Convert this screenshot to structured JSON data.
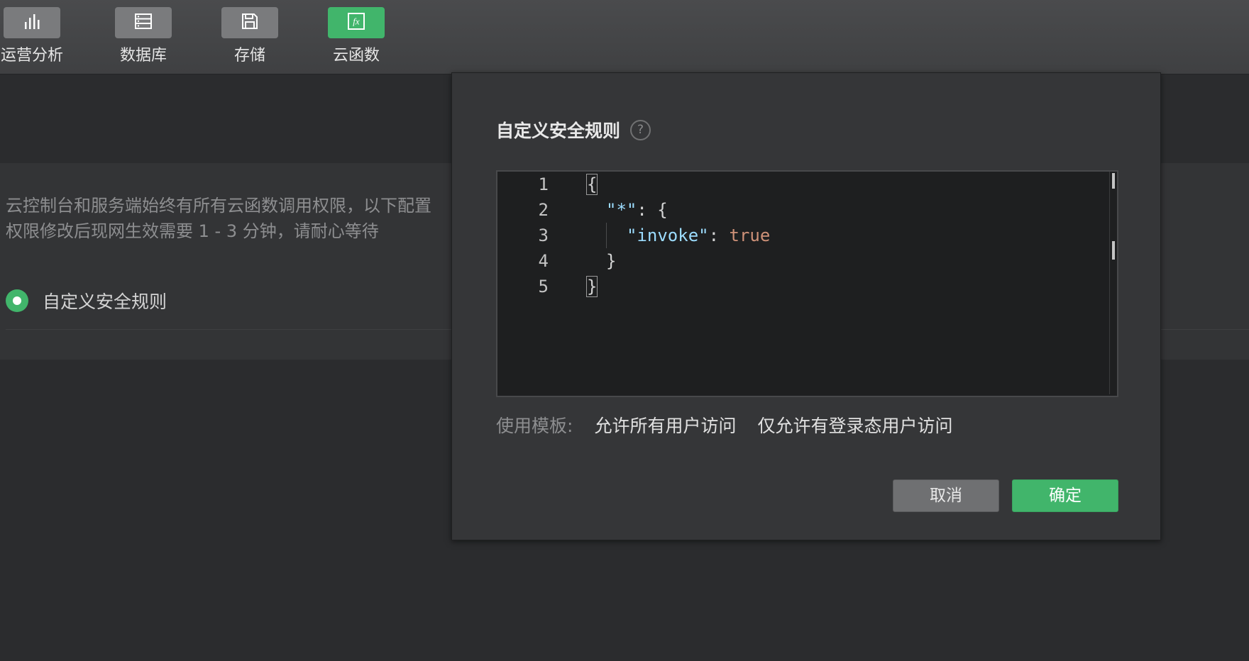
{
  "toolbar": {
    "items": [
      {
        "label": "运营分析",
        "icon": "bar-chart-icon",
        "active": false
      },
      {
        "label": "数据库",
        "icon": "database-icon",
        "active": false
      },
      {
        "label": "存储",
        "icon": "save-icon",
        "active": false
      },
      {
        "label": "云函数",
        "icon": "function-fx-icon",
        "active": true
      }
    ]
  },
  "background": {
    "description_line1": "云控制台和服务端始终有所有云函数调用权限，以下配置",
    "description_line2": "权限修改后现网生效需要 1 - 3 分钟，请耐心等待",
    "selected_option": "自定义安全规则"
  },
  "modal": {
    "title": "自定义安全规则",
    "help_icon": "?",
    "editor": {
      "line_numbers": [
        "1",
        "2",
        "3",
        "4",
        "5"
      ],
      "lines": {
        "l1_open": "{",
        "l2_key": "\"*\"",
        "l2_rest": ": {",
        "l3_key": "\"invoke\"",
        "l3_colon": ": ",
        "l3_value": "true",
        "l4": "}",
        "l5_close": "}"
      }
    },
    "template_label": "使用模板:",
    "templates": [
      "允许所有用户访问",
      "仅允许有登录态用户访问"
    ],
    "cancel_label": "取消",
    "confirm_label": "确定"
  },
  "colors": {
    "accent": "#41b56b",
    "background": "#2b2c2e",
    "modal": "#353638",
    "editor": "#1e1f20",
    "string": "#9cdcfe",
    "keyword": "#ce9178"
  }
}
